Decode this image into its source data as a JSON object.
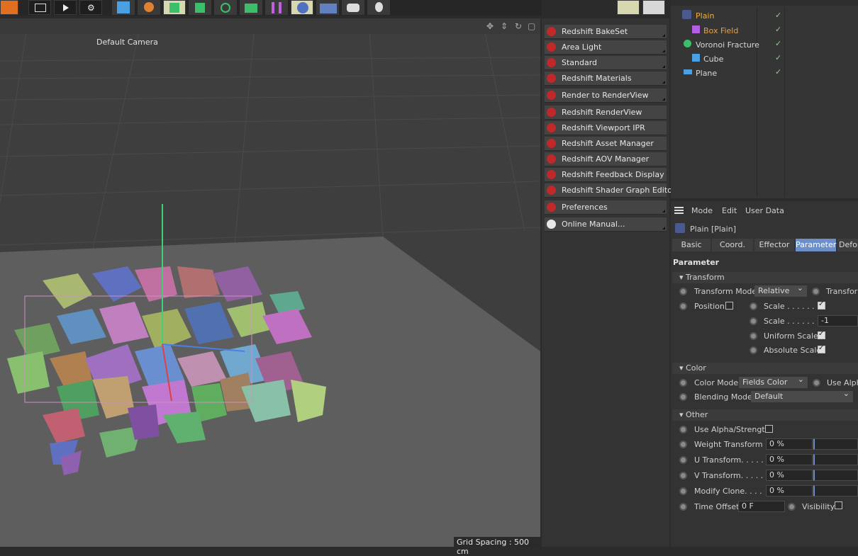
{
  "viewport": {
    "camera": "Default Camera",
    "grid_spacing": "Grid Spacing : 500 cm"
  },
  "menu": {
    "items": [
      {
        "label": "Redshift BakeSet"
      },
      {
        "label": "Area Light"
      },
      {
        "label": "Standard"
      },
      {
        "label": "Redshift Materials"
      },
      {
        "label": "Render to RenderView"
      },
      {
        "label": "Redshift RenderView"
      },
      {
        "label": "Redshift Viewport IPR"
      },
      {
        "label": "Redshift Asset Manager"
      },
      {
        "label": "Redshift AOV Manager"
      },
      {
        "label": "Redshift Feedback Display"
      },
      {
        "label": "Redshift Shader Graph Editor"
      },
      {
        "label": "Preferences"
      },
      {
        "label": "Online Manual..."
      }
    ]
  },
  "objects": {
    "rows": [
      {
        "name": "Plain"
      },
      {
        "name": "Box Field"
      },
      {
        "name": "Voronoi Fracture"
      },
      {
        "name": "Cube"
      },
      {
        "name": "Plane"
      }
    ]
  },
  "attr": {
    "menu": {
      "mode": "Mode",
      "edit": "Edit",
      "user_data": "User Data"
    },
    "object_title": "Plain [Plain]",
    "tabs": [
      "Basic",
      "Coord.",
      "Effector",
      "Parameter",
      "Defor"
    ],
    "section_title": "Parameter",
    "transform": {
      "header": "Transform",
      "transform_mode_label": "Transform Mode",
      "transform_mode_value": "Relative",
      "transform_label": "Transform",
      "position_label": "Position",
      "scale_label_1": "Scale . . . . . .",
      "scale_label_2": "Scale . . . . . .",
      "scale_value": "-1",
      "uniform_scale_label": "Uniform Scale",
      "absolute_scale_label": "Absolute Scale"
    },
    "color": {
      "header": "Color",
      "color_mode_label": "Color Mode",
      "color_mode_value": "Fields Color",
      "use_alpha_label": "Use Alph",
      "blending_mode_label": "Blending Mode",
      "blending_mode_value": "Default"
    },
    "other": {
      "header": "Other",
      "use_alpha_strength": "Use Alpha/Strength",
      "weight_transform": "Weight Transform",
      "weight_transform_value": "0 %",
      "u_transform": "U Transform. . . . .",
      "u_transform_value": "0 %",
      "v_transform": "V Transform. . . . .",
      "v_transform_value": "0 %",
      "modify_clone": "Modify Clone. . . .",
      "modify_clone_value": "0 %",
      "time_offset": "Time Offset",
      "time_offset_value": "0 F",
      "visibility": "Visibility"
    }
  }
}
